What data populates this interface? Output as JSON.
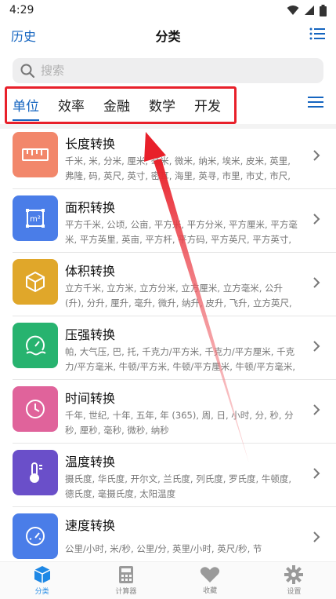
{
  "status": {
    "time": "4:29"
  },
  "header": {
    "left": "历史",
    "title": "分类"
  },
  "search": {
    "placeholder": "搜索"
  },
  "tabs": [
    {
      "label": "单位",
      "active": true
    },
    {
      "label": "效率",
      "active": false
    },
    {
      "label": "金融",
      "active": false
    },
    {
      "label": "数学",
      "active": false
    },
    {
      "label": "开发",
      "active": false
    }
  ],
  "items": [
    {
      "name": "长度转换",
      "desc": "千米, 米, 分米, 厘米, 毫米, 微米, 纳米, 埃米, 皮米, 英里, 弗隆, 码, 英尺, 英寸, 密耳, 海里, 英寻, 市里, 市丈, 市尺, 市寸, 市…",
      "color": "#f2876b",
      "icon": "ruler-icon"
    },
    {
      "name": "面积转换",
      "desc": "平方千米, 公顷, 公亩, 平方米, 平方分米, 平方厘米, 平方毫米, 平方英里, 英亩, 平方杆, 平方码, 平方英尺, 平方英寸, 顷, 亩,…",
      "color": "#4a7de8",
      "icon": "area-icon"
    },
    {
      "name": "体积转换",
      "desc": "立方千米, 立方米, 立方分米, 立方厘米, 立方毫米, 公升 (升), 分升, 厘升, 毫升, 微升, 纳升, 皮升, 飞升, 立方英尺, 立方英…",
      "color": "#e0a72a",
      "icon": "cube-icon"
    },
    {
      "name": "压强转换",
      "desc": "帕, 大气压, 巴, 托, 千克力/平方米, 千克力/平方厘米, 千克力/平方毫米, 牛顿/平方米, 牛顿/平方厘米, 牛顿/平方毫米, 工…",
      "color": "#27b36f",
      "icon": "gauge-icon"
    },
    {
      "name": "时间转换",
      "desc": "千年, 世纪, 十年, 五年, 年 (365), 周, 日, 小时, 分, 秒, 分秒, 厘秒, 毫秒, 微秒, 纳秒",
      "color": "#e0639b",
      "icon": "clock-icon"
    },
    {
      "name": "温度转换",
      "desc": "摄氏度, 华氏度, 开尔文, 兰氏度, 列氏度, 罗氏度, 牛顿度, 德氏度, 毫摄氏度, 太阳温度",
      "color": "#6a4fc9",
      "icon": "thermometer-icon"
    },
    {
      "name": "速度转换",
      "desc": "公里/小时, 米/秒, 公里/分, 英里/小时, 英尺/秒, 节",
      "color": "#4a7de8",
      "icon": "speedometer-icon"
    }
  ],
  "bottomnav": [
    {
      "label": "分类",
      "active": true,
      "icon": "cube-icon"
    },
    {
      "label": "计算器",
      "active": false,
      "icon": "calculator-icon"
    },
    {
      "label": "收藏",
      "active": false,
      "icon": "heart-icon"
    },
    {
      "label": "设置",
      "active": false,
      "icon": "gear-icon"
    }
  ],
  "colors": {
    "accent": "#1565c0",
    "annotation": "#e8202a"
  }
}
